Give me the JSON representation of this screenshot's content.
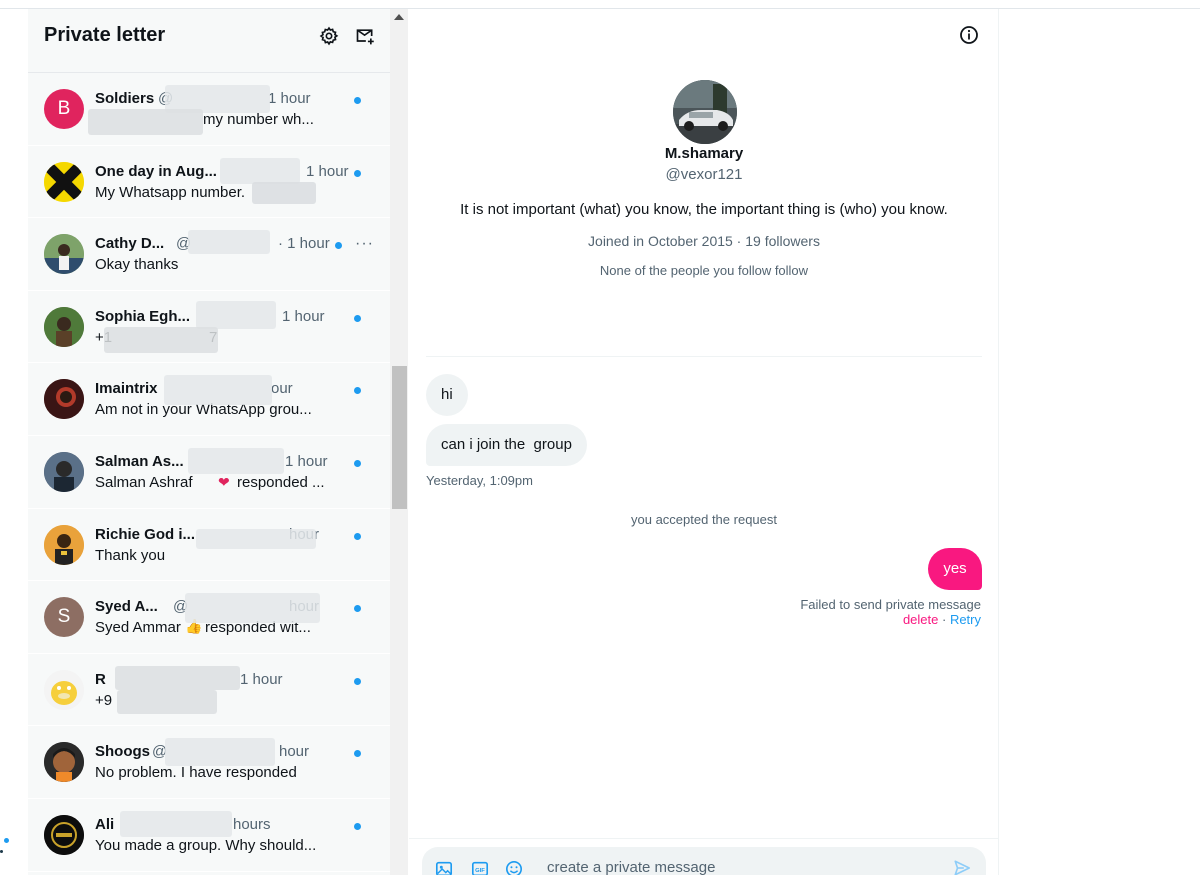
{
  "sidebar": {
    "title": "Private letter",
    "conversations": [
      {
        "name": "Soldiers",
        "handle": "@",
        "time": "1 hour",
        "preview": "my number wh...",
        "avatar_letter": "B",
        "avatar_color": "#e0245e",
        "unread": true
      },
      {
        "name": "One day in Aug...",
        "handle": "",
        "time": "1 hour",
        "preview": "My Whatsapp number.",
        "avatar_letter": "",
        "avatar_color": "#1a1a1a",
        "unread": true
      },
      {
        "name": "Cathy D...",
        "handle": "@",
        "time": "· 1 hour",
        "preview": "Okay thanks",
        "avatar_letter": "",
        "avatar_color": "#4a6b3a",
        "unread": true,
        "more": "···"
      },
      {
        "name": "Sophia Egh...",
        "handle": "",
        "time": "1 hour",
        "preview": "+1",
        "preview_tail": "7",
        "avatar_letter": "",
        "avatar_color": "#3d5a2b",
        "unread": true
      },
      {
        "name": "Imaintrix",
        "handle": "",
        "time": "our",
        "preview": "Am not in your WhatsApp grou...",
        "avatar_letter": "",
        "avatar_color": "#5a2020",
        "unread": true
      },
      {
        "name": "Salman As...",
        "handle": "",
        "time": "1 hour",
        "preview": "Salman Ashraf",
        "preview_tail": "responded ...",
        "avatar_letter": "",
        "avatar_color": "#2f3e4f",
        "unread": true
      },
      {
        "name": "Richie God i...",
        "handle": "",
        "time": "hour",
        "preview": "Thank you",
        "avatar_letter": "",
        "avatar_color": "#e0a020",
        "unread": true
      },
      {
        "name": "Syed A...",
        "handle": "@",
        "time": "hour",
        "preview": "Syed Ammar",
        "preview_tail": "responded wit...",
        "avatar_letter": "S",
        "avatar_color": "#8d6e63",
        "unread": true
      },
      {
        "name": "R",
        "handle": "",
        "time": "1 hour",
        "preview": "+9",
        "avatar_letter": "",
        "avatar_color": "#f4d03f",
        "unread": true
      },
      {
        "name": "Shoogs",
        "handle": "@",
        "time": "hour",
        "preview": "No problem. I have responded",
        "avatar_letter": "",
        "avatar_color": "#2b2b2b",
        "unread": true
      },
      {
        "name": "Ali",
        "handle": "",
        "time": "hours",
        "preview": "You made a group. Why should...",
        "avatar_letter": "",
        "avatar_color": "#111111",
        "unread": true
      }
    ]
  },
  "profile": {
    "name": "M.shamary",
    "handle": "@vexor121",
    "bio": "It is not important (what) you know, the important thing is (who) you know.",
    "joined": "Joined in October 2015 · 19 followers",
    "mutual": "None of the people you follow follow"
  },
  "messages": {
    "incoming_1": "hi",
    "incoming_2": "can i join the  group",
    "incoming_timestamp": "Yesterday, 1:09pm",
    "system_note": "you accepted the request",
    "outgoing_1": "yes",
    "failed_text": "Failed to send private message",
    "delete_label": "delete",
    "separator": " · ",
    "retry_label": "Retry"
  },
  "composer": {
    "placeholder": "create a private message",
    "gif_label": "GIF"
  },
  "colors": {
    "accent": "#1d9bf0",
    "outgoing_bubble": "#f91880",
    "incoming_bubble": "#eff3f4",
    "sidebar_bg": "#f7f9f9"
  }
}
